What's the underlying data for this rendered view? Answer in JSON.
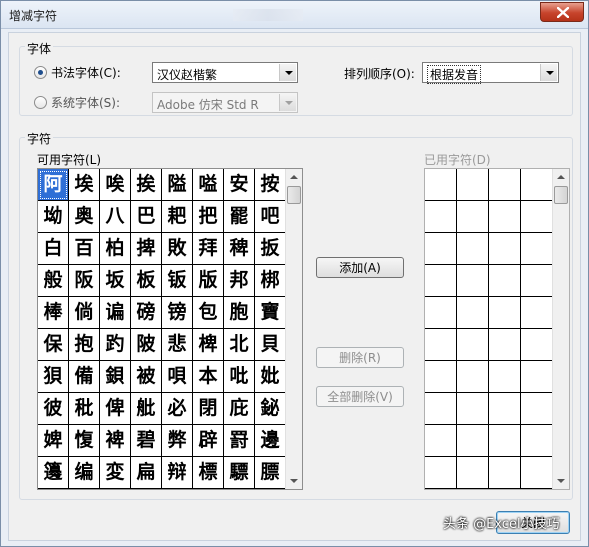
{
  "window": {
    "title": "增减字符"
  },
  "font_group": {
    "label": "字体",
    "calligraphy_radio": {
      "label": "书法字体(C):",
      "selected": true
    },
    "calligraphy_combo": {
      "value": "汉仪赵楷繁"
    },
    "system_radio": {
      "label": "系统字体(S):",
      "selected": false
    },
    "system_combo": {
      "value": "Adobe 仿宋 Std R",
      "enabled": false
    },
    "sort_label": "排列顺序(O):",
    "sort_combo": {
      "value": "根据发音"
    }
  },
  "char_group": {
    "label": "字符",
    "available_label": "可用字符(L)",
    "used_label": "已用字符(D)",
    "available_chars": [
      "阿",
      "埃",
      "唉",
      "挨",
      "隘",
      "嗌",
      "安",
      "按",
      "坳",
      "奥",
      "八",
      "巴",
      "耙",
      "把",
      "罷",
      "吧",
      "白",
      "百",
      "柏",
      "捭",
      "敗",
      "拜",
      "稗",
      "扳",
      "般",
      "阪",
      "坂",
      "板",
      "钣",
      "版",
      "邦",
      "梆",
      "棒",
      "倘",
      "谝",
      "磅",
      "镑",
      "包",
      "胞",
      "寶",
      "保",
      "抱",
      "趵",
      "陂",
      "悲",
      "椑",
      "北",
      "貝",
      "狽",
      "備",
      "鋇",
      "被",
      "唄",
      "本",
      "吡",
      "妣",
      "彼",
      "秕",
      "俾",
      "舭",
      "必",
      "閉",
      "庇",
      "鉍",
      "婢",
      "愎",
      "裨",
      "碧",
      "弊",
      "辟",
      "罸",
      "邊",
      "籩",
      "编",
      "変",
      "扁",
      "辩",
      "標",
      "驃",
      "膘"
    ],
    "selected_char_index": 0,
    "used_rows": 10
  },
  "buttons": {
    "add": "添加(A)",
    "delete": "删除(R)",
    "delete_all": "全部删除(V)",
    "close": "关闭"
  },
  "watermark": "头条 @Excel小技巧",
  "colors": {
    "selection": "#2f6fd6",
    "close_button": "#c7442c"
  }
}
